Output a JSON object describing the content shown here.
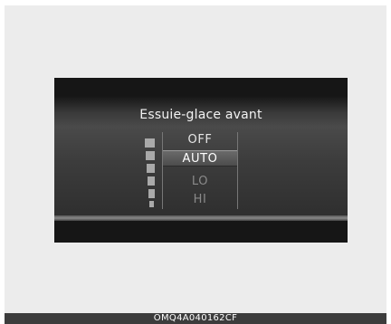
{
  "display": {
    "title": "Essuie-glace avant",
    "menu_items": [
      {
        "label": "OFF",
        "state": "normal"
      },
      {
        "label": "AUTO",
        "state": "selected"
      },
      {
        "label": "LO",
        "state": "dim"
      },
      {
        "label": "HI",
        "state": "dim"
      }
    ],
    "sensitivity_indicator": "level-bars-icon"
  },
  "caption": {
    "code": "OMQ4A040162CF"
  },
  "colors": {
    "screen_background": "#161616",
    "selection_highlight": "#5a5a5a",
    "text_primary": "#f2f2f2",
    "text_dim": "#8a8a8a",
    "caption_background": "#3c3c3c"
  }
}
